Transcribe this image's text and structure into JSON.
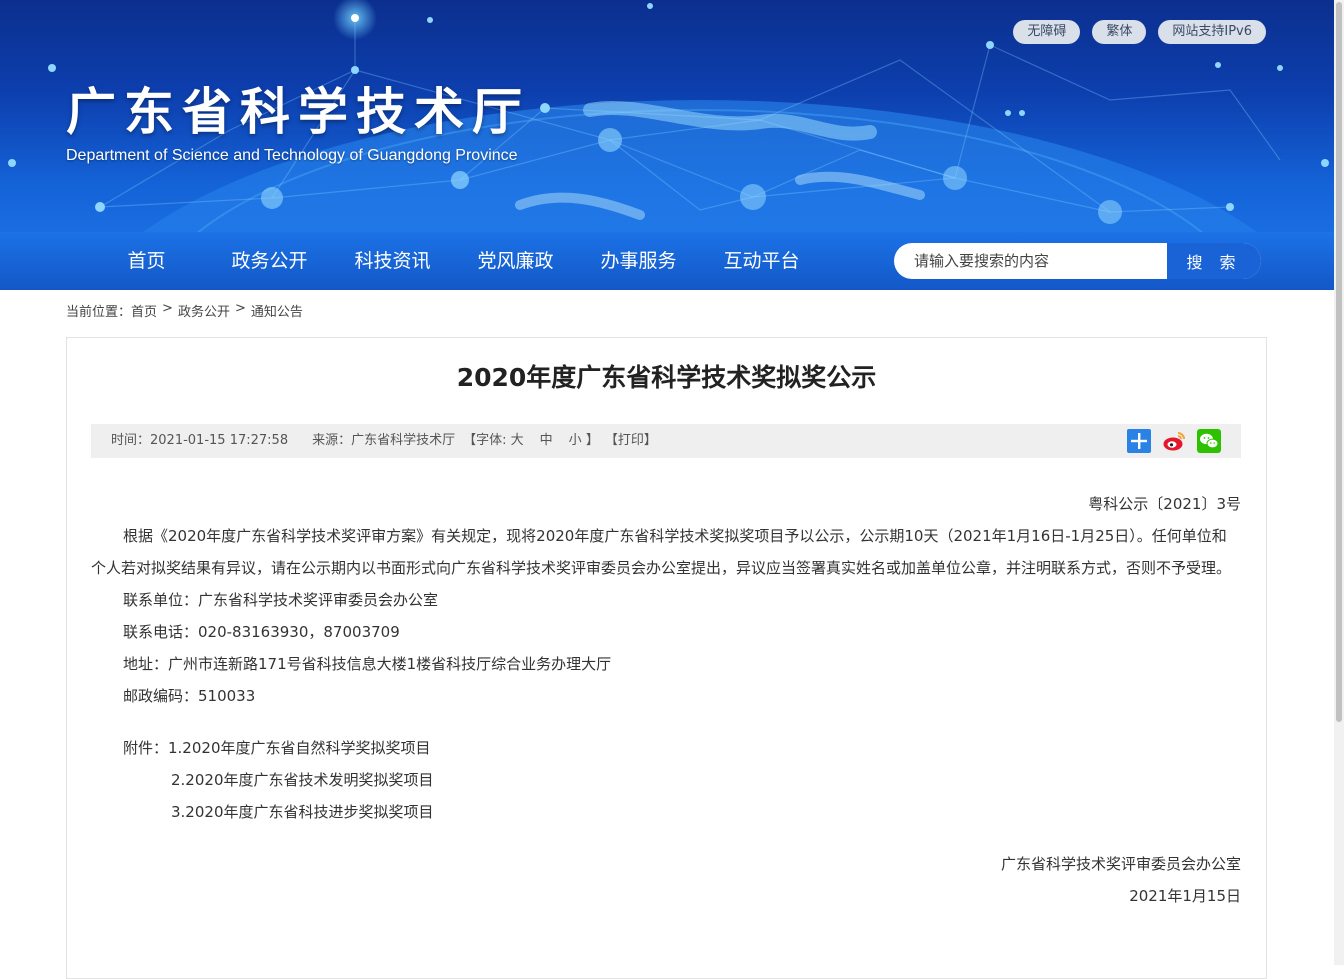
{
  "header": {
    "title": "广东省科学技术厅",
    "subtitle": "Department of Science and Technology of Guangdong Province",
    "top_links": [
      "无障碍",
      "繁体",
      "网站支持IPv6"
    ]
  },
  "nav": {
    "items": [
      "首页",
      "政务公开",
      "科技资讯",
      "党风廉政",
      "办事服务",
      "互动平台"
    ]
  },
  "search": {
    "placeholder": "请输入要搜索的内容",
    "button_label": "搜 索"
  },
  "breadcrumb": {
    "prefix": "当前位置：",
    "items": [
      "首页",
      "政务公开",
      "通知公告"
    ],
    "separator": ">"
  },
  "article": {
    "title": "2020年度广东省科学技术奖拟奖公示",
    "meta": {
      "time_label": "时间：",
      "time_value": "2021-01-15 17:27:58",
      "source_label": "来源：",
      "source_value": "广东省科学技术厅",
      "font_open": "【字体: ",
      "font_large": "大",
      "font_medium": "中",
      "font_small": "小",
      "font_close": " 】",
      "print": "【打印】"
    },
    "share_icons": [
      "share-plus-icon",
      "weibo-icon",
      "wechat-icon"
    ],
    "doc_number": "粤科公示〔2021〕3号",
    "paragraph": "根据《2020年度广东省科学技术奖评审方案》有关规定，现将2020年度广东省科学技术奖拟奖项目予以公示，公示期10天（2021年1月16日-1月25日）。任何单位和个人若对拟奖结果有异议，请在公示期内以书面形式向广东省科学技术奖评审委员会办公室提出，异议应当签署真实姓名或加盖单位公章，并注明联系方式，否则不予受理。",
    "contact_unit": "联系单位：广东省科学技术奖评审委员会办公室",
    "contact_phone": "联系电话：020-83163930，87003709",
    "address": "地址：广州市连新路171号省科技信息大楼1楼省科技厅综合业务办理大厅",
    "postcode": "邮政编码：510033",
    "attachments": [
      "附件：1.2020年度广东省自然科学奖拟奖项目",
      "2.2020年度广东省技术发明奖拟奖项目",
      "3.2020年度广东省科技进步奖拟奖项目"
    ],
    "signature_org": "广东省科学技术奖评审委员会办公室",
    "signature_date": "2021年1月15日"
  },
  "colors": {
    "banner_dark": "#0b2f8e",
    "banner_light": "#1a6de0",
    "nav_bar": "#1c72e6",
    "search_button": "#1a63d6",
    "share_plus": "#2a82e4",
    "weibo": "#e6162d",
    "wechat": "#2dc100"
  }
}
